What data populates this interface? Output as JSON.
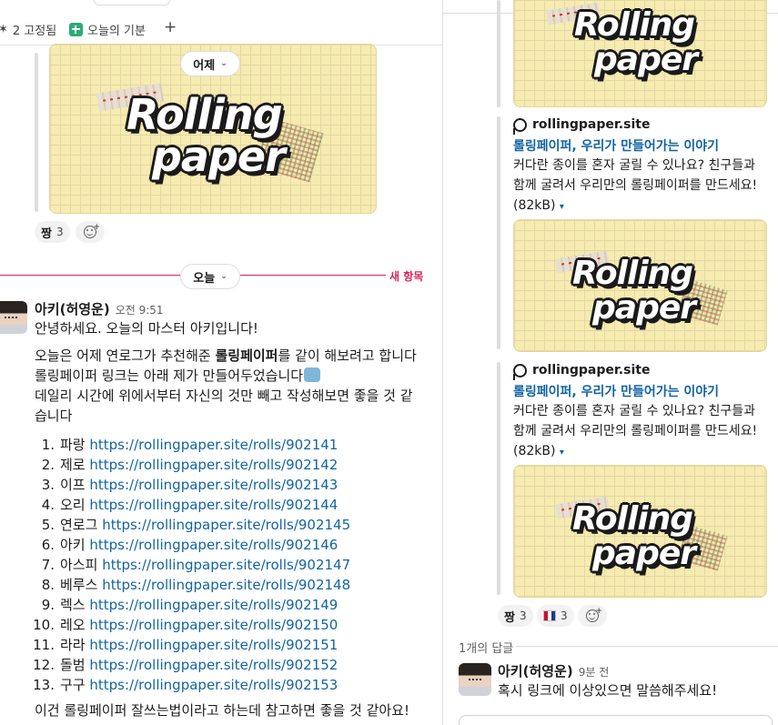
{
  "topbar": {
    "pinned_label": "2 고정됨",
    "canvas_label": "오늘의 기분",
    "add_label": "+"
  },
  "logo": {
    "line1": "Rolling",
    "line2": "paper"
  },
  "dividers": {
    "yesterday": "어제",
    "today": "오늘",
    "new_items": "새 항목"
  },
  "reactions_top": {
    "emoji": "짱",
    "count": "3"
  },
  "message": {
    "author": "아키(허영운)",
    "time": "오전 9:51",
    "greeting": "안녕하세요. 오늘의 마스터 아키입니다!",
    "para1_before": "오늘은 어제 연로그가 추천해준 ",
    "para1_bold": "롤링페이퍼",
    "para1_after": "를 같이 해보려고 합니다",
    "para2": "롤링페이퍼 링크는 아래 제가 만들어두었습니다",
    "para3": "데일리 시간에 위에서부터 자신의 것만 빼고 작성해보면 좋을 것 같습니다",
    "rolls": [
      {
        "num": "1.",
        "name": "파랑",
        "url": "https://rollingpaper.site/rolls/902141"
      },
      {
        "num": "2.",
        "name": "제로",
        "url": "https://rollingpaper.site/rolls/902142"
      },
      {
        "num": "3.",
        "name": "이프",
        "url": "https://rollingpaper.site/rolls/902143"
      },
      {
        "num": "4.",
        "name": "오리",
        "url": "https://rollingpaper.site/rolls/902144"
      },
      {
        "num": "5.",
        "name": "연로그",
        "url": "https://rollingpaper.site/rolls/902145"
      },
      {
        "num": "6.",
        "name": "아키",
        "url": "https://rollingpaper.site/rolls/902146"
      },
      {
        "num": "7.",
        "name": "아스피",
        "url": "https://rollingpaper.site/rolls/902147"
      },
      {
        "num": "8.",
        "name": "베루스",
        "url": "https://rollingpaper.site/rolls/902148"
      },
      {
        "num": "9.",
        "name": "렉스",
        "url": "https://rollingpaper.site/rolls/902149"
      },
      {
        "num": "10.",
        "name": "레오",
        "url": "https://rollingpaper.site/rolls/902150"
      },
      {
        "num": "11.",
        "name": "라라",
        "url": "https://rollingpaper.site/rolls/902151"
      },
      {
        "num": "12.",
        "name": "돌범",
        "url": "https://rollingpaper.site/rolls/902152"
      },
      {
        "num": "13.",
        "name": "구구",
        "url": "https://rollingpaper.site/rolls/902153"
      }
    ],
    "footer": "이건 롤링페이퍼 잘쓰는법이라고 하는데 참고하면 좋을 것 같아요!"
  },
  "thread": {
    "unfurls": [
      {
        "site": "rollingpaper.site",
        "title": "롤링페이퍼, 우리가 만들어가는 이야기",
        "desc": "커다란 종이를 혼자 굴릴 수 있나요? 친구들과 함께 굴려서 우리만의 롤링페이퍼를 만드세요! (82kB)"
      },
      {
        "site": "rollingpaper.site",
        "title": "롤링페이퍼, 우리가 만들어가는 이야기",
        "desc": "커다란 종이를 혼자 굴릴 수 있나요? 친구들과 함께 굴려서 우리만의 롤링페이퍼를 만드세요! (82kB)"
      }
    ],
    "reactions": [
      {
        "emoji": "짱",
        "count": "3"
      },
      {
        "emoji": "flag-emoji",
        "count": "3"
      }
    ],
    "reply_count": "1개의 답글",
    "reply": {
      "author": "아키(허영운)",
      "time": "9분 전",
      "text": "혹시 링크에 이상있으면 말씀해주세요!"
    }
  }
}
